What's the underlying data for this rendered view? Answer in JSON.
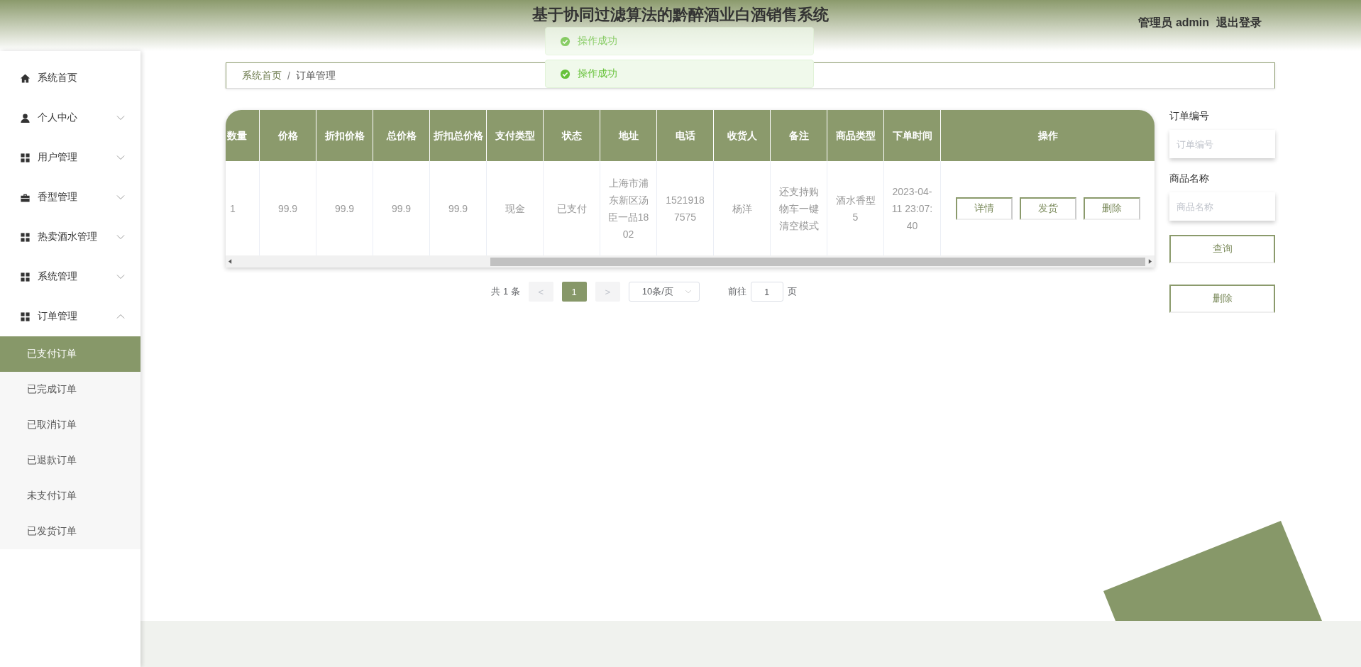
{
  "header": {
    "title": "基于协同过滤算法的黔醉酒业白酒销售系统",
    "user_label": "管理员 admin",
    "logout": "退出登录"
  },
  "toasts": [
    {
      "text": "操作成功",
      "faded": true
    },
    {
      "text": "操作成功",
      "faded": false
    }
  ],
  "sidebar": {
    "items": [
      {
        "label": "系统首页",
        "kind": "link"
      },
      {
        "label": "个人中心",
        "kind": "menu",
        "expanded": false
      },
      {
        "label": "用户管理",
        "kind": "menu",
        "expanded": false
      },
      {
        "label": "香型管理",
        "kind": "menu",
        "expanded": false
      },
      {
        "label": "热卖酒水管理",
        "kind": "menu",
        "expanded": false
      },
      {
        "label": "系统管理",
        "kind": "menu",
        "expanded": false
      },
      {
        "label": "订单管理",
        "kind": "menu",
        "expanded": true,
        "children": [
          {
            "label": "已支付订单",
            "selected": true
          },
          {
            "label": "已完成订单",
            "selected": false
          },
          {
            "label": "已取消订单",
            "selected": false
          },
          {
            "label": "已退款订单",
            "selected": false
          },
          {
            "label": "未支付订单",
            "selected": false
          },
          {
            "label": "已发货订单",
            "selected": false
          }
        ]
      }
    ]
  },
  "breadcrumb": {
    "items": [
      "系统首页",
      "订单管理"
    ],
    "separator": "/"
  },
  "table": {
    "columns": [
      "数量",
      "价格",
      "折扣价格",
      "总价格",
      "折扣总价格",
      "支付类型",
      "状态",
      "地址",
      "电话",
      "收货人",
      "备注",
      "商品类型",
      "下单时间",
      "操作"
    ],
    "rows": [
      {
        "cells": [
          "1",
          "99.9",
          "99.9",
          "99.9",
          "99.9",
          "现金",
          "已支付",
          "上海市浦东新区汤臣一品1802",
          "15219187575",
          "杨洋",
          "还支持购物车一键清空模式",
          "酒水香型5",
          "2023-04-11 23:07:40"
        ],
        "actions": [
          "详情",
          "发货",
          "删除"
        ]
      }
    ]
  },
  "pagination": {
    "total": "共 1 条",
    "prev": "<",
    "pages": [
      {
        "label": "1",
        "selected": true
      }
    ],
    "next": ">",
    "page_size": "10条/页",
    "goto_label": "前往",
    "goto_value": "1",
    "page_suffix": "页"
  },
  "search": {
    "fields": [
      {
        "label": "订单编号",
        "placeholder": "订单编号"
      },
      {
        "label": "商品名称",
        "placeholder": "商品名称"
      }
    ],
    "buttons": [
      "查询",
      "删除"
    ]
  }
}
